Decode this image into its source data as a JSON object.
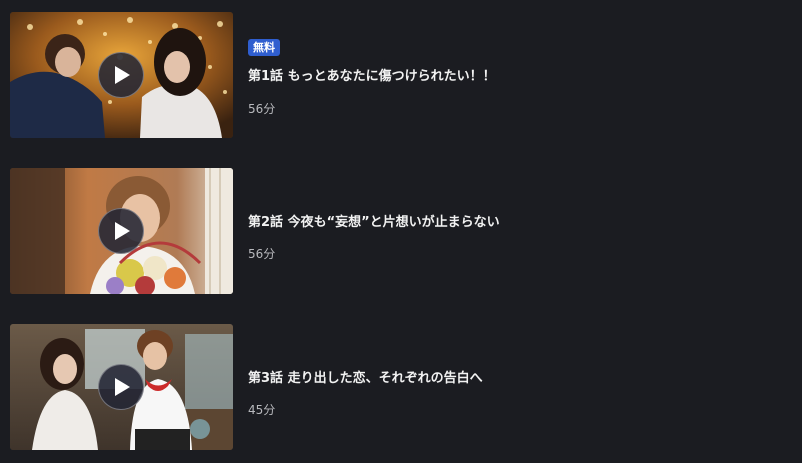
{
  "episodes": [
    {
      "badge": "無料",
      "title": "第1話 もっとあなたに傷つけられたい！！",
      "duration": "56分"
    },
    {
      "title": "第2話 今夜も“妄想”と片想いが止まらない",
      "duration": "56分"
    },
    {
      "title": "第3話 走り出した恋、それぞれの告白へ",
      "duration": "45分"
    }
  ],
  "colors": {
    "background": "#1b1c21",
    "badge": "#2f5ecf",
    "title_text": "#f2f2f2",
    "duration_text": "#b8b9bd"
  },
  "icons": {
    "play": "play-icon"
  }
}
